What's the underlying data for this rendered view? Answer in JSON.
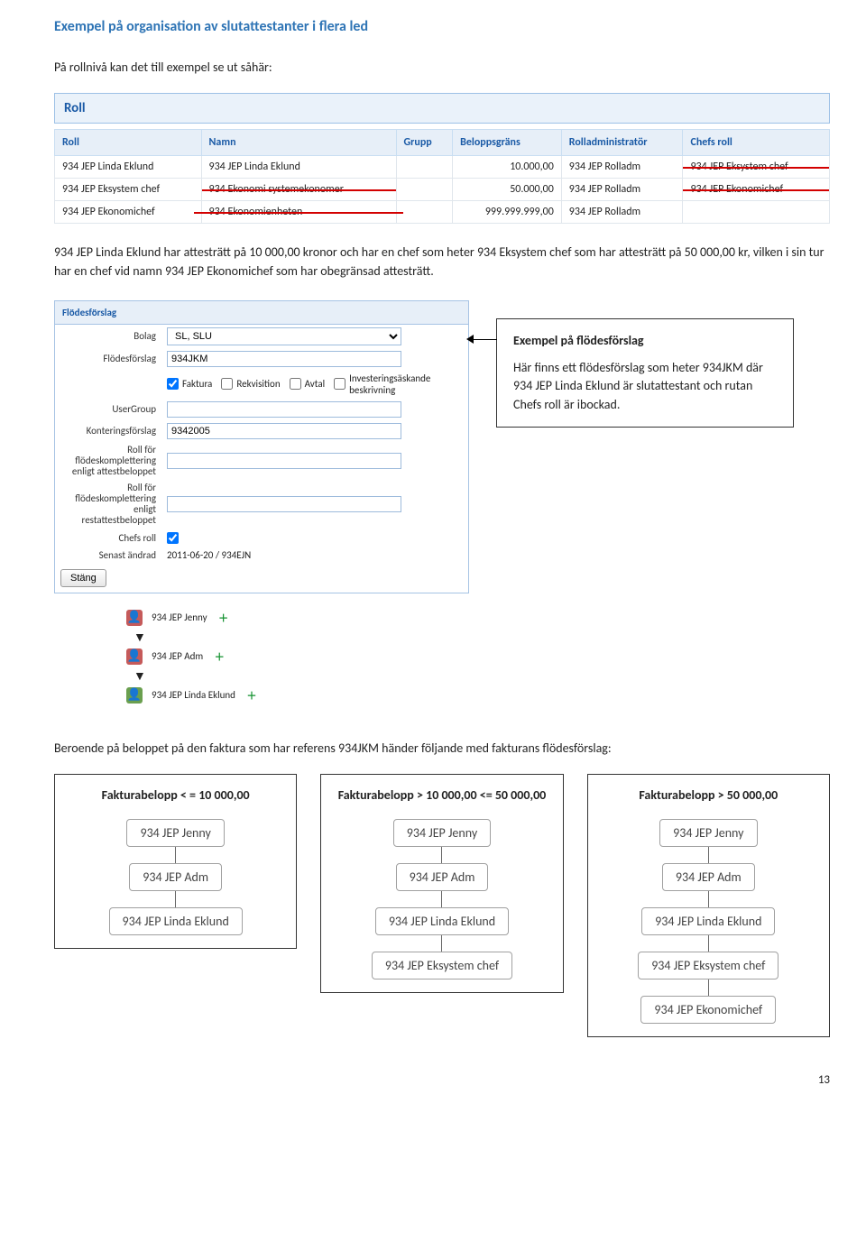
{
  "heading": "Exempel på organisation av slutattestanter i flera led",
  "intro": "På rollnivå kan det till exempel se ut såhär:",
  "roll_panel_title": "Roll",
  "roll_headers": [
    "Roll",
    "Namn",
    "Grupp",
    "Beloppsgräns",
    "Rolladministratör",
    "Chefs roll"
  ],
  "roll_rows": [
    {
      "roll": "934 JEP Linda Eklund",
      "namn": "934 JEP Linda Eklund",
      "grupp": "",
      "belopp": "10.000,00",
      "admin": "934 JEP Rolladm",
      "chef": "934 JEP Eksystem chef"
    },
    {
      "roll": "934 JEP Eksystem chef",
      "namn": "934 Ekonomi systemekonomer",
      "grupp": "",
      "belopp": "50.000,00",
      "admin": "934 JEP Rolladm",
      "chef": "934 JEP Ekonomichef"
    },
    {
      "roll": "934 JEP Ekonomichef",
      "namn": "934 Ekonomienheten",
      "grupp": "",
      "belopp": "999.999.999,00",
      "admin": "934 JEP Rolladm",
      "chef": ""
    }
  ],
  "para2": "934 JEP Linda Eklund har attesträtt på 10 000,00 kronor och har en chef som heter 934 Eksystem chef som har attesträtt på 50 000,00 kr, vilken i sin tur har en chef vid namn 934 JEP Ekonomichef som har obegränsad attesträtt.",
  "form": {
    "title": "Flödesförslag",
    "bolag_label": "Bolag",
    "bolag_value": "SL, SLU",
    "ff_label": "Flödesförslag",
    "ff_value": "934JKM",
    "checks": {
      "faktura": "Faktura",
      "rekvisition": "Rekvisition",
      "avtal": "Avtal",
      "invest": "Investeringsäskande beskrivning"
    },
    "usergroup_label": "UserGroup",
    "kont_label": "Konteringsförslag",
    "kont_value": "9342005",
    "roll_att_label": "Roll för flödeskomplettering enligt attestbeloppet",
    "roll_rest_label": "Roll för flödeskomplettering enligt restattestbeloppet",
    "chef_label": "Chefs roll",
    "chef_checked": true,
    "senast_label": "Senast ändrad",
    "senast_value": "2011-06-20 / 934EJN",
    "stang": "Stäng"
  },
  "callout": {
    "title": "Exempel på flödesförslag",
    "body": "Här finns ett flödesförslag som heter 934JKM där 934 JEP Linda Eklund är slutattestant och rutan Chefs roll är ibockad."
  },
  "steps": [
    {
      "color": "red",
      "name": "934 JEP Jenny"
    },
    {
      "color": "red",
      "name": "934 JEP Adm"
    },
    {
      "color": "green",
      "name": "934 JEP Linda Eklund"
    }
  ],
  "para3": "Beroende på beloppet på den faktura som har referens 934JKM händer följande med fakturans flödesförslag:",
  "cols": [
    {
      "header": "Fakturabelopp < = 10 000,00",
      "nodes": [
        "934 JEP Jenny",
        "934 JEP Adm",
        "934 JEP Linda Eklund"
      ]
    },
    {
      "header": "Fakturabelopp > 10 000,00 <= 50 000,00",
      "nodes": [
        "934 JEP Jenny",
        "934 JEP Adm",
        "934 JEP Linda Eklund",
        "934 JEP Eksystem chef"
      ]
    },
    {
      "header": "Fakturabelopp > 50 000,00",
      "nodes": [
        "934 JEP Jenny",
        "934 JEP Adm",
        "934 JEP Linda Eklund",
        "934 JEP Eksystem chef",
        "934 JEP Ekonomichef"
      ]
    }
  ],
  "page_num": "13"
}
